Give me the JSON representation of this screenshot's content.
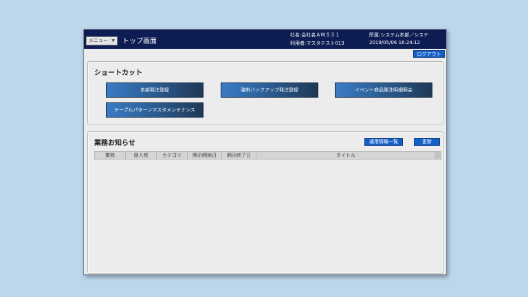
{
  "header": {
    "menu_label": "メニュー",
    "screen_title": "トップ画面",
    "company": "社名:会社名ＡＷＳ３１",
    "user": "利用者:マスタテスト013",
    "department": "所属:システム本部／システ",
    "datetime": "2019/05/06 16:24:12",
    "logout_label": "ログアウト"
  },
  "shortcuts": {
    "title": "ショートカット",
    "buttons": [
      "本部発注登録",
      "強制バックアップ発注登録",
      "イベント商品発注明細照会",
      "テーブルパターンマスタメンテナンス"
    ]
  },
  "notices": {
    "title": "業務お知らせ",
    "ops_info_label": "運用情報一覧",
    "refresh_label": "更新",
    "columns": [
      "業務",
      "個人宛",
      "カテゴリ",
      "開示開始日",
      "開示終了日",
      "タイトル"
    ]
  }
}
